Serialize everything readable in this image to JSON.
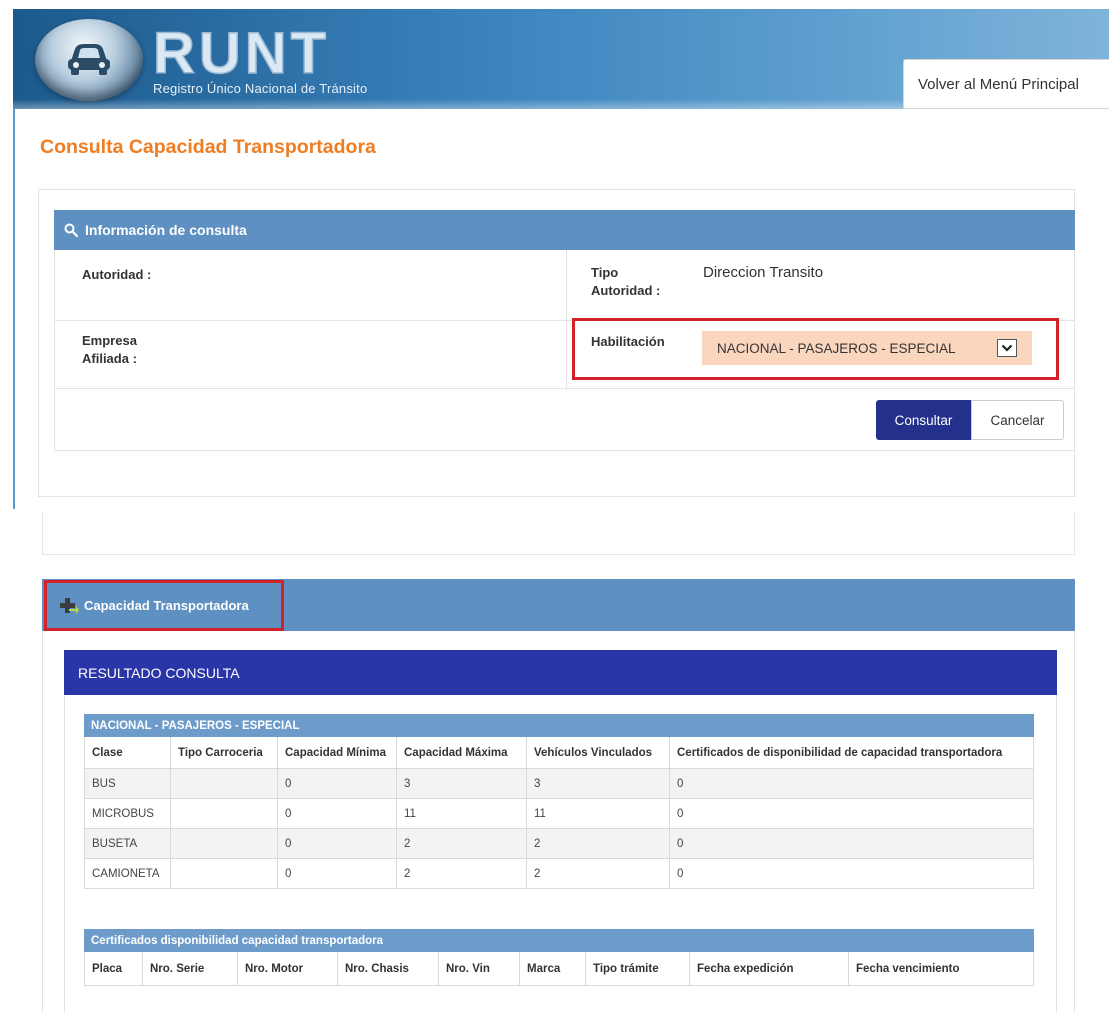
{
  "header": {
    "logo_text": "RUNT",
    "logo_subtitle": "Registro Único Nacional de Tránsito",
    "back_menu_label": "Volver al Menú Principal"
  },
  "page_title": "Consulta Capacidad Transportadora",
  "consulta_panel": {
    "title": "Información de consulta",
    "autoridad_label": "Autoridad :",
    "autoridad_value": "",
    "tipo_autoridad_label": "Tipo Autoridad :",
    "tipo_autoridad_value": "Direccion Transito",
    "empresa_label": "Empresa Afiliada :",
    "empresa_value": "",
    "habilitacion_label": "Habilitación",
    "habilitacion_selected": "NACIONAL - PASAJEROS - ESPECIAL",
    "consultar_label": "Consultar",
    "cancelar_label": "Cancelar"
  },
  "capacidad_panel": {
    "title": "Capacidad Transportadora",
    "result_title": "RESULTADO CONSULTA",
    "table1": {
      "caption": "NACIONAL - PASAJEROS - ESPECIAL",
      "headers": [
        "Clase",
        "Tipo Carroceria",
        "Capacidad Mínima",
        "Capacidad Máxima",
        "Vehículos Vinculados",
        "Certificados de disponibilidad de capacidad transportadora"
      ],
      "rows": [
        [
          "BUS",
          "",
          "0",
          "3",
          "3",
          "0"
        ],
        [
          "MICROBUS",
          "",
          "0",
          "11",
          "11",
          "0"
        ],
        [
          "BUSETA",
          "",
          "0",
          "2",
          "2",
          "0"
        ],
        [
          "CAMIONETA",
          "",
          "0",
          "2",
          "2",
          "0"
        ]
      ]
    },
    "table2": {
      "caption": "Certificados disponibilidad capacidad transportadora",
      "headers": [
        "Placa",
        "Nro. Serie",
        "Nro. Motor",
        "Nro. Chasis",
        "Nro. Vin",
        "Marca",
        "Tipo trámite",
        "Fecha expedición",
        "Fecha vencimiento"
      ]
    }
  },
  "colors": {
    "title_orange": "#ef7d22",
    "panel_blue": "#5e90c2",
    "result_blue": "#2a35a8",
    "button_blue": "#23308c",
    "highlight_red": "#d2232a",
    "select_peach": "#fbd6bf"
  },
  "icons": {
    "search": "search-icon",
    "plus": "plus-icon",
    "dropdown": "chevron-down-icon",
    "car": "car-icon"
  }
}
